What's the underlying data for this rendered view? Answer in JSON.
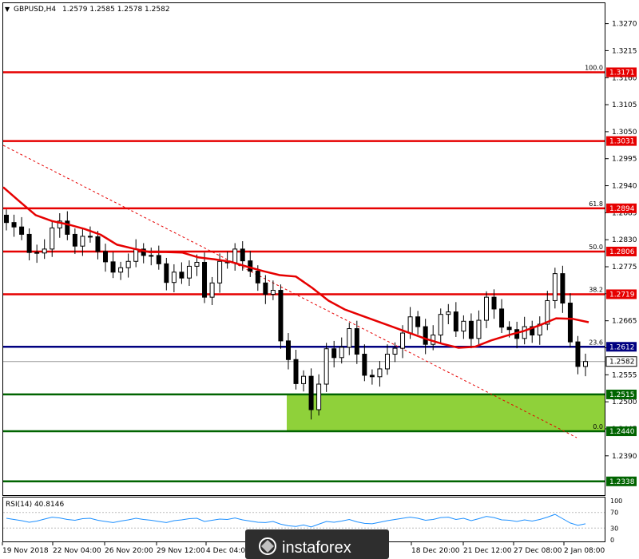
{
  "chart_data": {
    "type": "candlestick",
    "symbol_label": "GBPUSD,H4",
    "ohlc_label": "1.2579 1.2585 1.2578 1.2582",
    "ylim": [
      1.231,
      1.331
    ],
    "y_ticks": [
      "1.3270",
      "1.3215",
      "1.3160",
      "1.3105",
      "1.3050",
      "1.2995",
      "1.2940",
      "1.2885",
      "1.2830",
      "1.2775",
      "1.2720",
      "1.2665",
      "1.2610",
      "1.2555",
      "1.2500",
      "1.2445",
      "1.2390"
    ],
    "x_ticks": [
      "19 Nov 2018",
      "22 Nov 04:00",
      "26 Nov 20:00",
      "29 Nov 12:00",
      "4 Dec 04:00",
      "18 Dec 20:00",
      "21 Dec 12:00",
      "27 Dec 08:00",
      "2 Jan 08:00"
    ],
    "horizontal_levels": [
      {
        "price": 1.3171,
        "label": "1.3171",
        "fib": "100.0",
        "color": "#e60000"
      },
      {
        "price": 1.3031,
        "label": "1.3031",
        "fib": "",
        "color": "#e60000"
      },
      {
        "price": 1.2894,
        "label": "1.2894",
        "fib": "61.8",
        "color": "#e60000"
      },
      {
        "price": 1.2806,
        "label": "1.2806",
        "fib": "50.0",
        "color": "#e60000"
      },
      {
        "price": 1.2719,
        "label": "1.2719",
        "fib": "38.2",
        "color": "#e60000"
      },
      {
        "price": 1.2612,
        "label": "1.2612",
        "fib": "23.6",
        "color": "#000080"
      },
      {
        "price": 1.2515,
        "label": "1.2515",
        "fib": "",
        "color": "#006400"
      },
      {
        "price": 1.244,
        "label": "1.2440",
        "fib": "0.0",
        "color": "#006400"
      },
      {
        "price": 1.2338,
        "label": "1.2338",
        "fib": "",
        "color": "#006400"
      }
    ],
    "current_price": "1.2582",
    "zone": {
      "top": 1.2515,
      "bottom": 1.244,
      "color": "#8fd13a"
    },
    "moving_average": [
      1.2937,
      1.2908,
      1.288,
      1.2868,
      1.2861,
      1.2852,
      1.284,
      1.282,
      1.2812,
      1.2805,
      1.2805,
      1.2804,
      1.2794,
      1.279,
      1.2785,
      1.2775,
      1.2766,
      1.2758,
      1.2755,
      1.2732,
      1.2706,
      1.2688,
      1.2676,
      1.2664,
      1.2652,
      1.264,
      1.2628,
      1.2618,
      1.261,
      1.2612,
      1.2625,
      1.2635,
      1.2644,
      1.2656,
      1.267,
      1.2669,
      1.2662
    ],
    "candles_close": [
      1.2865,
      1.2856,
      1.2841,
      1.2804,
      1.2803,
      1.2811,
      1.2854,
      1.2868,
      1.2841,
      1.2817,
      1.2837,
      1.2836,
      1.2806,
      1.2785,
      1.2764,
      1.2773,
      1.2786,
      1.2811,
      1.2798,
      1.2798,
      1.2781,
      1.2743,
      1.2764,
      1.2752,
      1.2776,
      1.2784,
      1.2713,
      1.2742,
      1.2786,
      1.2783,
      1.2811,
      1.2787,
      1.2766,
      1.2742,
      1.2719,
      1.2727,
      1.2624,
      1.2586,
      1.2537,
      1.2552,
      1.2484,
      1.2536,
      1.2608,
      1.259,
      1.2611,
      1.2649,
      1.2597,
      1.2554,
      1.2551,
      1.2567,
      1.2597,
      1.2609,
      1.264,
      1.2673,
      1.2653,
      1.2617,
      1.2636,
      1.2678,
      1.2683,
      1.2644,
      1.2664,
      1.2629,
      1.2666,
      1.2713,
      1.2689,
      1.2652,
      1.2647,
      1.2629,
      1.2653,
      1.2636,
      1.2658,
      1.2706,
      1.2761,
      1.2701,
      1.2622,
      1.2572,
      1.2582
    ],
    "rsi": {
      "label": "RSI(14) 40.8146",
      "levels": [
        "100",
        "70",
        "30",
        "0"
      ],
      "values": [
        55,
        52,
        49,
        45,
        48,
        53,
        58,
        56,
        52,
        50,
        54,
        55,
        50,
        47,
        44,
        48,
        51,
        55,
        52,
        50,
        47,
        44,
        49,
        51,
        54,
        55,
        47,
        50,
        53,
        52,
        56,
        51,
        48,
        45,
        44,
        47,
        40,
        36,
        34,
        38,
        33,
        40,
        47,
        45,
        48,
        52,
        46,
        42,
        41,
        45,
        49,
        52,
        55,
        58,
        55,
        50,
        52,
        57,
        58,
        52,
        55,
        49,
        54,
        60,
        57,
        51,
        50,
        47,
        51,
        48,
        52,
        58,
        65,
        54,
        43,
        37,
        41
      ]
    },
    "watermark": "instaforex"
  }
}
